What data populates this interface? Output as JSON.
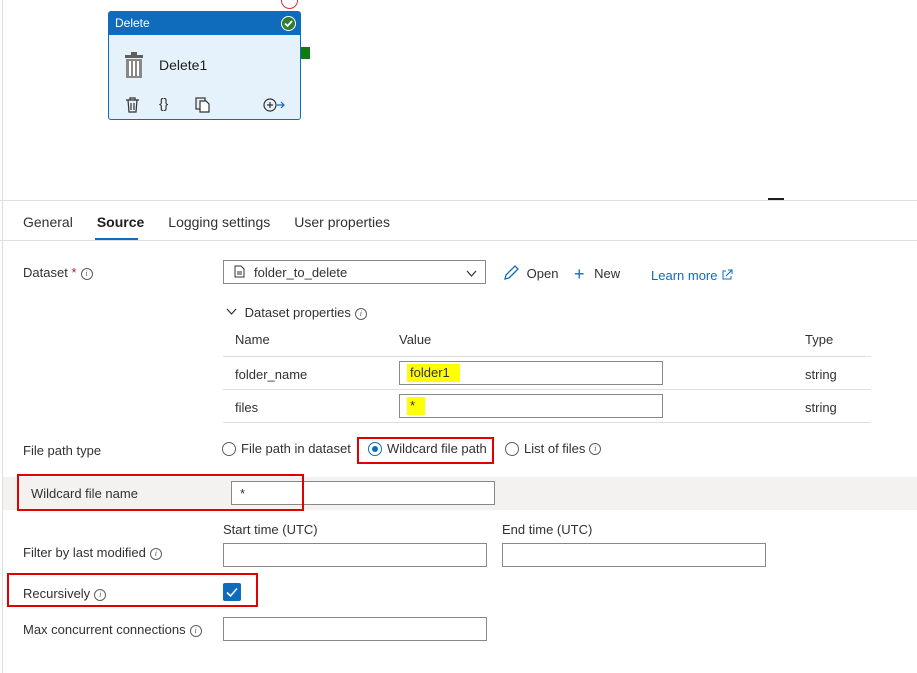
{
  "node": {
    "type_label": "Delete",
    "name": "Delete1"
  },
  "tabs": [
    {
      "label": "General",
      "active": false
    },
    {
      "label": "Source",
      "active": true
    },
    {
      "label": "Logging settings",
      "active": false
    },
    {
      "label": "User properties",
      "active": false
    }
  ],
  "dataset": {
    "label": "Dataset",
    "required_mark": "*",
    "value": "folder_to_delete",
    "open_label": "Open",
    "new_label": "New",
    "learn_more": "Learn more"
  },
  "dataset_properties": {
    "toggle_label": "Dataset properties",
    "columns": [
      "Name",
      "Value",
      "Type"
    ],
    "rows": [
      {
        "name": "folder_name",
        "value": "folder1",
        "type": "string"
      },
      {
        "name": "files",
        "value": "*",
        "type": "string"
      }
    ]
  },
  "file_path_type": {
    "label": "File path type",
    "options": [
      "File path in dataset",
      "Wildcard file path",
      "List of files"
    ],
    "selected": "Wildcard file path"
  },
  "wildcard_file_name": {
    "label": "Wildcard file name",
    "value": "*"
  },
  "filter_last_modified": {
    "label": "Filter by last modified",
    "start_label": "Start time (UTC)",
    "end_label": "End time (UTC)",
    "start_value": "",
    "end_value": ""
  },
  "recursively": {
    "label": "Recursively",
    "checked": true
  },
  "max_concurrent": {
    "label": "Max concurrent connections",
    "value": ""
  },
  "colors": {
    "accent": "#0f6cbd",
    "highlight": "#ffff00",
    "annotation": "#e00000"
  }
}
